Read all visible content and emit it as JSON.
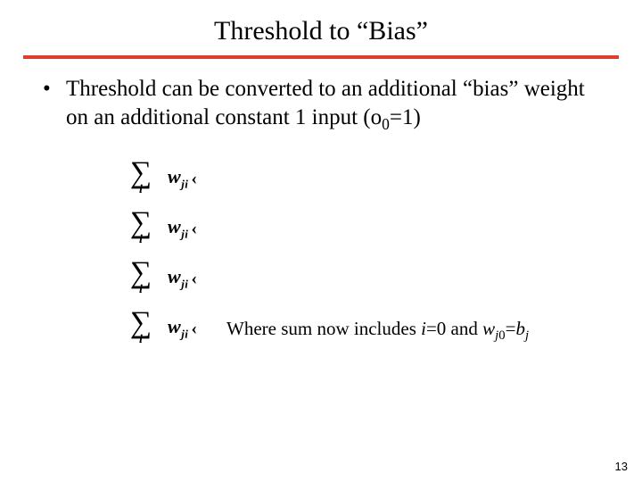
{
  "title": "Threshold to “Bias”",
  "bullet": {
    "marker": "•",
    "text_pre": "Threshold can be converted to an additional “bias” weight on an additional constant 1 input (o",
    "sub": "0",
    "text_post": "=1)"
  },
  "formula": {
    "sigma": "∑",
    "index": "i",
    "w": "w",
    "w_sub": "ji",
    "trail": "‹"
  },
  "caption": {
    "pre": "Where sum now includes ",
    "i": "i",
    "eq0": "=0 and ",
    "w": "w",
    "wsub_j": "j",
    "wsub_0": "0",
    "eq": "=",
    "b": "b",
    "bsub": "j"
  },
  "page_number": "13"
}
